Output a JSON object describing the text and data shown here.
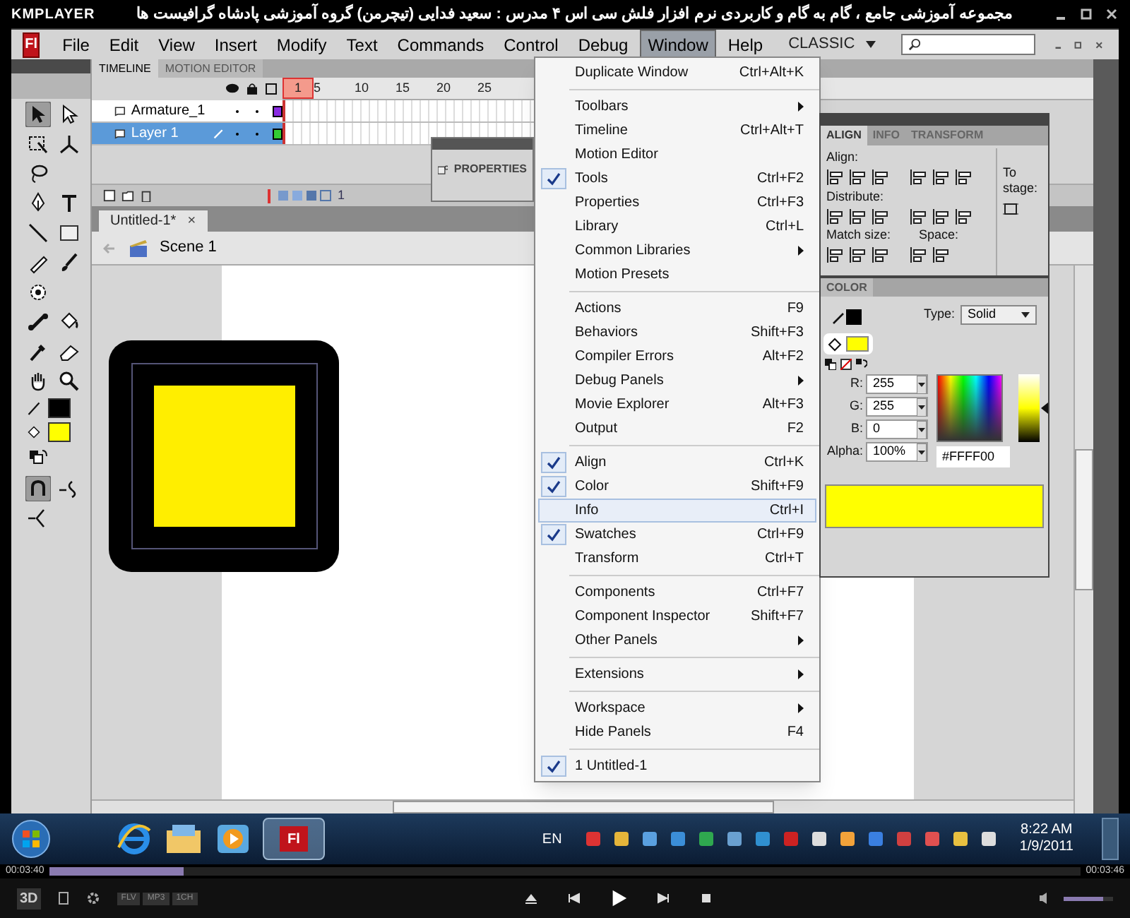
{
  "player": {
    "logo": "KMPLAYER",
    "title": "مجموعه آموزشی جامع ، گام به گام و کاربردی نرم افزار فلش سی اس ۴ مدرس : سعید فدایی (تیچرمن) گروه آموزشی پادشاه گرافیست ها"
  },
  "app": {
    "logo": "Fl",
    "menus": [
      {
        "label": "File",
        "selected": false
      },
      {
        "label": "Edit",
        "selected": false
      },
      {
        "label": "View",
        "selected": false
      },
      {
        "label": "Insert",
        "selected": false
      },
      {
        "label": "Modify",
        "selected": false
      },
      {
        "label": "Text",
        "selected": false
      },
      {
        "label": "Commands",
        "selected": false
      },
      {
        "label": "Control",
        "selected": false
      },
      {
        "label": "Debug",
        "selected": false
      },
      {
        "label": "Window",
        "selected": true
      },
      {
        "label": "Help",
        "selected": false
      }
    ],
    "workspace": "CLASSIC"
  },
  "tools": [
    [
      {
        "kind": "selection",
        "selected": true
      },
      {
        "kind": "subselection",
        "selected": false
      }
    ],
    [
      {
        "kind": "transform",
        "selected": false
      },
      {
        "kind": "rotation",
        "selected": false
      }
    ],
    [
      {
        "kind": "lasso",
        "selected": false
      }
    ],
    [
      {
        "kind": "pen",
        "selected": false
      },
      {
        "kind": "text",
        "selected": false
      }
    ],
    [
      {
        "kind": "line",
        "selected": false
      },
      {
        "kind": "rectangle",
        "selected": false
      }
    ],
    [
      {
        "kind": "pencil",
        "selected": false
      },
      {
        "kind": "brush",
        "selected": false
      }
    ],
    [
      {
        "kind": "deco",
        "selected": false
      }
    ],
    [
      {
        "kind": "bone",
        "selected": false
      },
      {
        "kind": "bucket",
        "selected": false
      }
    ],
    [
      {
        "kind": "eyedropper",
        "selected": false
      },
      {
        "kind": "eraser",
        "selected": false
      }
    ],
    [
      {
        "kind": "hand",
        "selected": false
      },
      {
        "kind": "zoom",
        "selected": false
      }
    ],
    [
      {
        "kind": "stroke",
        "color": "#000000"
      }
    ],
    [
      {
        "kind": "fill",
        "color": "#ffff00"
      }
    ],
    [
      {
        "kind": "swap",
        "selected": false
      }
    ],
    [
      {
        "kind": "snap",
        "selected": true
      },
      {
        "kind": "smooth",
        "selected": false
      }
    ],
    [
      {
        "kind": "straighten",
        "selected": false
      }
    ]
  ],
  "timeline": {
    "tabs": [
      {
        "label": "TIMELINE",
        "selected": true
      },
      {
        "label": "MOTION EDITOR",
        "selected": false
      }
    ],
    "layers": [
      {
        "name": "Armature_1",
        "color": "#8a2be2",
        "selected": false
      },
      {
        "name": "Layer 1",
        "color": "#33cc33",
        "selected": true
      }
    ],
    "ruler": [
      "1",
      "5",
      "10",
      "15",
      "20",
      "25"
    ],
    "current_frame": "1"
  },
  "properties_panel": {
    "title": "PROPERTIES"
  },
  "document": {
    "tab": "Untitled-1*",
    "close": "×",
    "scene": "Scene 1"
  },
  "window_menu": [
    {
      "kind": "item",
      "label": "Duplicate Window",
      "shortcut": "Ctrl+Alt+K",
      "checked": false,
      "submenu": false,
      "selected": false
    },
    {
      "kind": "separator"
    },
    {
      "kind": "item",
      "label": "Toolbars",
      "checked": false,
      "submenu": true,
      "selected": false
    },
    {
      "kind": "item",
      "label": "Timeline",
      "shortcut": "Ctrl+Alt+T",
      "checked": false,
      "submenu": false,
      "selected": false
    },
    {
      "kind": "item",
      "label": "Motion Editor",
      "checked": false,
      "submenu": false,
      "selected": false
    },
    {
      "kind": "item",
      "label": "Tools",
      "shortcut": "Ctrl+F2",
      "checked": true,
      "submenu": false,
      "selected": false
    },
    {
      "kind": "item",
      "label": "Properties",
      "shortcut": "Ctrl+F3",
      "checked": false,
      "submenu": false,
      "selected": false
    },
    {
      "kind": "item",
      "label": "Library",
      "shortcut": "Ctrl+L",
      "checked": false,
      "submenu": false,
      "selected": false
    },
    {
      "kind": "item",
      "label": "Common Libraries",
      "checked": false,
      "submenu": true,
      "selected": false
    },
    {
      "kind": "item",
      "label": "Motion Presets",
      "checked": false,
      "submenu": false,
      "selected": false
    },
    {
      "kind": "separator"
    },
    {
      "kind": "item",
      "label": "Actions",
      "shortcut": "F9",
      "checked": false,
      "submenu": false,
      "selected": false
    },
    {
      "kind": "item",
      "label": "Behaviors",
      "shortcut": "Shift+F3",
      "checked": false,
      "submenu": false,
      "selected": false
    },
    {
      "kind": "item",
      "label": "Compiler Errors",
      "shortcut": "Alt+F2",
      "checked": false,
      "submenu": false,
      "selected": false
    },
    {
      "kind": "item",
      "label": "Debug Panels",
      "checked": false,
      "submenu": true,
      "selected": false
    },
    {
      "kind": "item",
      "label": "Movie Explorer",
      "shortcut": "Alt+F3",
      "checked": false,
      "submenu": false,
      "selected": false
    },
    {
      "kind": "item",
      "label": "Output",
      "shortcut": "F2",
      "checked": false,
      "submenu": false,
      "selected": false
    },
    {
      "kind": "separator"
    },
    {
      "kind": "item",
      "label": "Align",
      "shortcut": "Ctrl+K",
      "checked": true,
      "submenu": false,
      "selected": false
    },
    {
      "kind": "item",
      "label": "Color",
      "shortcut": "Shift+F9",
      "checked": true,
      "submenu": false,
      "selected": false
    },
    {
      "kind": "item",
      "label": "Info",
      "shortcut": "Ctrl+I",
      "checked": false,
      "submenu": false,
      "selected": true
    },
    {
      "kind": "item",
      "label": "Swatches",
      "shortcut": "Ctrl+F9",
      "checked": true,
      "submenu": false,
      "selected": false
    },
    {
      "kind": "item",
      "label": "Transform",
      "shortcut": "Ctrl+T",
      "checked": false,
      "submenu": false,
      "selected": false
    },
    {
      "kind": "separator"
    },
    {
      "kind": "item",
      "label": "Components",
      "shortcut": "Ctrl+F7",
      "checked": false,
      "submenu": false,
      "selected": false
    },
    {
      "kind": "item",
      "label": "Component Inspector",
      "shortcut": "Shift+F7",
      "checked": false,
      "submenu": false,
      "selected": false
    },
    {
      "kind": "item",
      "label": "Other Panels",
      "checked": false,
      "submenu": true,
      "selected": false
    },
    {
      "kind": "separator"
    },
    {
      "kind": "item",
      "label": "Extensions",
      "checked": false,
      "submenu": true,
      "selected": false
    },
    {
      "kind": "separator"
    },
    {
      "kind": "item",
      "label": "Workspace",
      "checked": false,
      "submenu": true,
      "selected": false
    },
    {
      "kind": "item",
      "label": "Hide Panels",
      "shortcut": "F4",
      "checked": false,
      "submenu": false,
      "selected": false
    },
    {
      "kind": "separator"
    },
    {
      "kind": "item",
      "label": "1 Untitled-1",
      "checked": true,
      "submenu": false,
      "selected": false
    }
  ],
  "align_panel": {
    "tabs": [
      {
        "label": "ALIGN",
        "selected": true
      },
      {
        "label": "INFO",
        "selected": false
      },
      {
        "label": "TRANSFORM",
        "selected": false
      }
    ],
    "align": "Align:",
    "distribute": "Distribute:",
    "match_size": "Match size:",
    "space": "Space:",
    "to_stage": "To stage:"
  },
  "color_panel": {
    "tab": "COLOR",
    "type_label": "Type:",
    "type": "Solid",
    "channels": [
      {
        "label": "R:",
        "value": "255"
      },
      {
        "label": "G:",
        "value": "255"
      },
      {
        "label": "B:",
        "value": "0"
      },
      {
        "label": "Alpha:",
        "value": "100%"
      }
    ],
    "hex": "#FFFF00",
    "brightness": {
      "level": 0.5
    }
  },
  "taskbar": {
    "app_logo": "Fl",
    "language": "EN",
    "time": "8:22 AM",
    "date": "1/9/2011"
  },
  "playback": {
    "mode_button": "3D",
    "elapsed": "00:03:40",
    "total": "00:03:46",
    "level": 0.13,
    "badges": [
      "FLV",
      "MP3",
      "1CH"
    ],
    "volume": {
      "level": 0.8
    }
  }
}
